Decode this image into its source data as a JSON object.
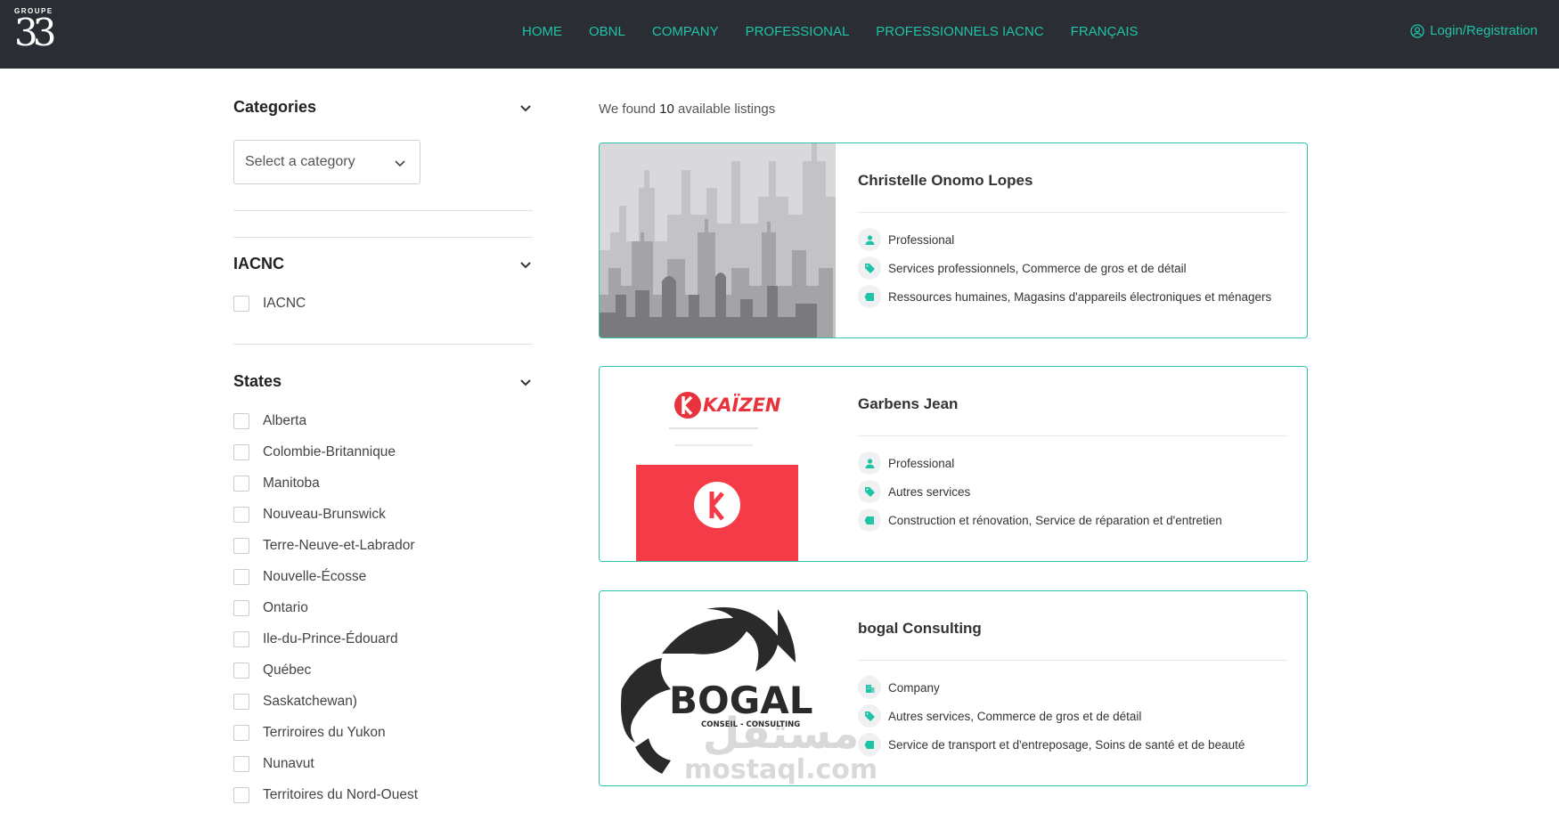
{
  "header": {
    "logo_small": "GROUPE",
    "logo_big": "33",
    "nav": [
      "HOME",
      "OBNL",
      "COMPANY",
      "PROFESSIONAL",
      "PROFESSIONNELS IACNC",
      "FRANÇAIS"
    ],
    "login_label": "Login/Registration",
    "accent_color": "#1fc3a6",
    "bg_color": "#2b2d34"
  },
  "sidebar": {
    "categories": {
      "title": "Categories",
      "select_value": "Select a category"
    },
    "iacnc": {
      "title": "IACNC",
      "option": "IACNC"
    },
    "states": {
      "title": "States",
      "items": [
        "Alberta",
        "Colombie-Britannique",
        "Manitoba",
        "Nouveau-Brunswick",
        "Terre-Neuve-et-Labrador",
        "Nouvelle-Écosse",
        "Ontario",
        "Ile-du-Prince-Édouard",
        "Québec",
        "Saskatchewan)",
        "Terriroires du Yukon",
        "Nunavut",
        "Territoires du Nord-Ouest"
      ]
    }
  },
  "results": {
    "found_prefix": "We found",
    "found_count": "10",
    "found_suffix": "available listings"
  },
  "listings": [
    {
      "title": "Christelle Onomo Lopes",
      "type": "Professional",
      "tags": "Services professionnels, Commerce de gros et de détail",
      "sectors": "Ressources humaines, Magasins d'appareils électroniques et ménagers",
      "thumb": "city-skyline-placeholder"
    },
    {
      "title": "Garbens Jean",
      "type": "Professional",
      "tags": "Autres services",
      "sectors": "Construction et rénovation, Service de réparation et d'entretien",
      "thumb": "kaizen-logo",
      "logo_text": "KAÏZEN"
    },
    {
      "title": "bogal Consulting",
      "type": "Company",
      "tags": "Autres services, Commerce de gros et de détail",
      "sectors": "Service de transport et d'entreposage, Soins de santé et de beauté",
      "thumb": "bogal-lion-logo",
      "logo_text": "BOGAL",
      "logo_subtext": "CONSEIL - CONSULTING"
    }
  ],
  "watermark": {
    "arabic": "مستقل",
    "latin": "mostaql.com"
  }
}
